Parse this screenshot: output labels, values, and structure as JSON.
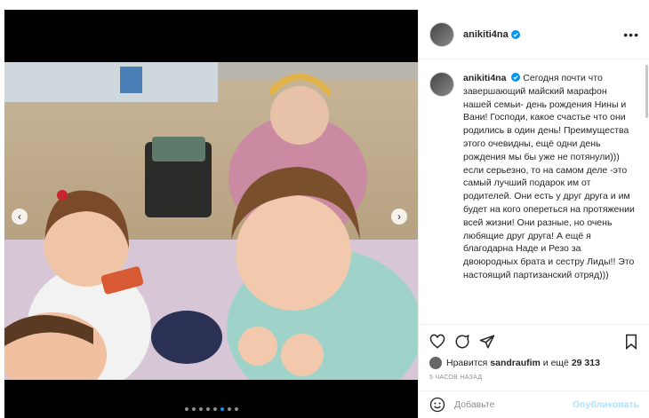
{
  "post": {
    "username": "anikiti4na",
    "caption": "Сегодня почти что завершающий майский марафон нашей семьи- день рождения Нины и Вани! Господи, какое счастье что они родились в один день! Преимущества этого очевидны, ещё одни день рождения мы бы уже не потянули))) если серьезно, то на самом деле -это самый лучший подарок им от родителей. Они есть у друг друга и им будет на кого опереться на протяжении всей жизни! Они разные, но очень любящие друг друга! А ещё я благодарна Наде и Резо за двоюродных брата и сестру Лиды!! Это настоящий партизанский отряд)))",
    "likes_prefix": "Нравится",
    "likes_user": "sandraufim",
    "likes_suffix": "и ещё",
    "likes_count": "29 313",
    "time": "5 часов назад",
    "add_comment_placeholder": "Добавьте",
    "publish_label": "Опубликовать",
    "more_label": "•••"
  },
  "carousel": {
    "prev_icon": "‹",
    "next_icon": "›",
    "dots": 8,
    "active_dot": 5
  },
  "colors": {
    "accent": "#0095f6",
    "publish_disabled": "#b2dffc",
    "text": "#262626",
    "muted": "#8e8e8e"
  }
}
